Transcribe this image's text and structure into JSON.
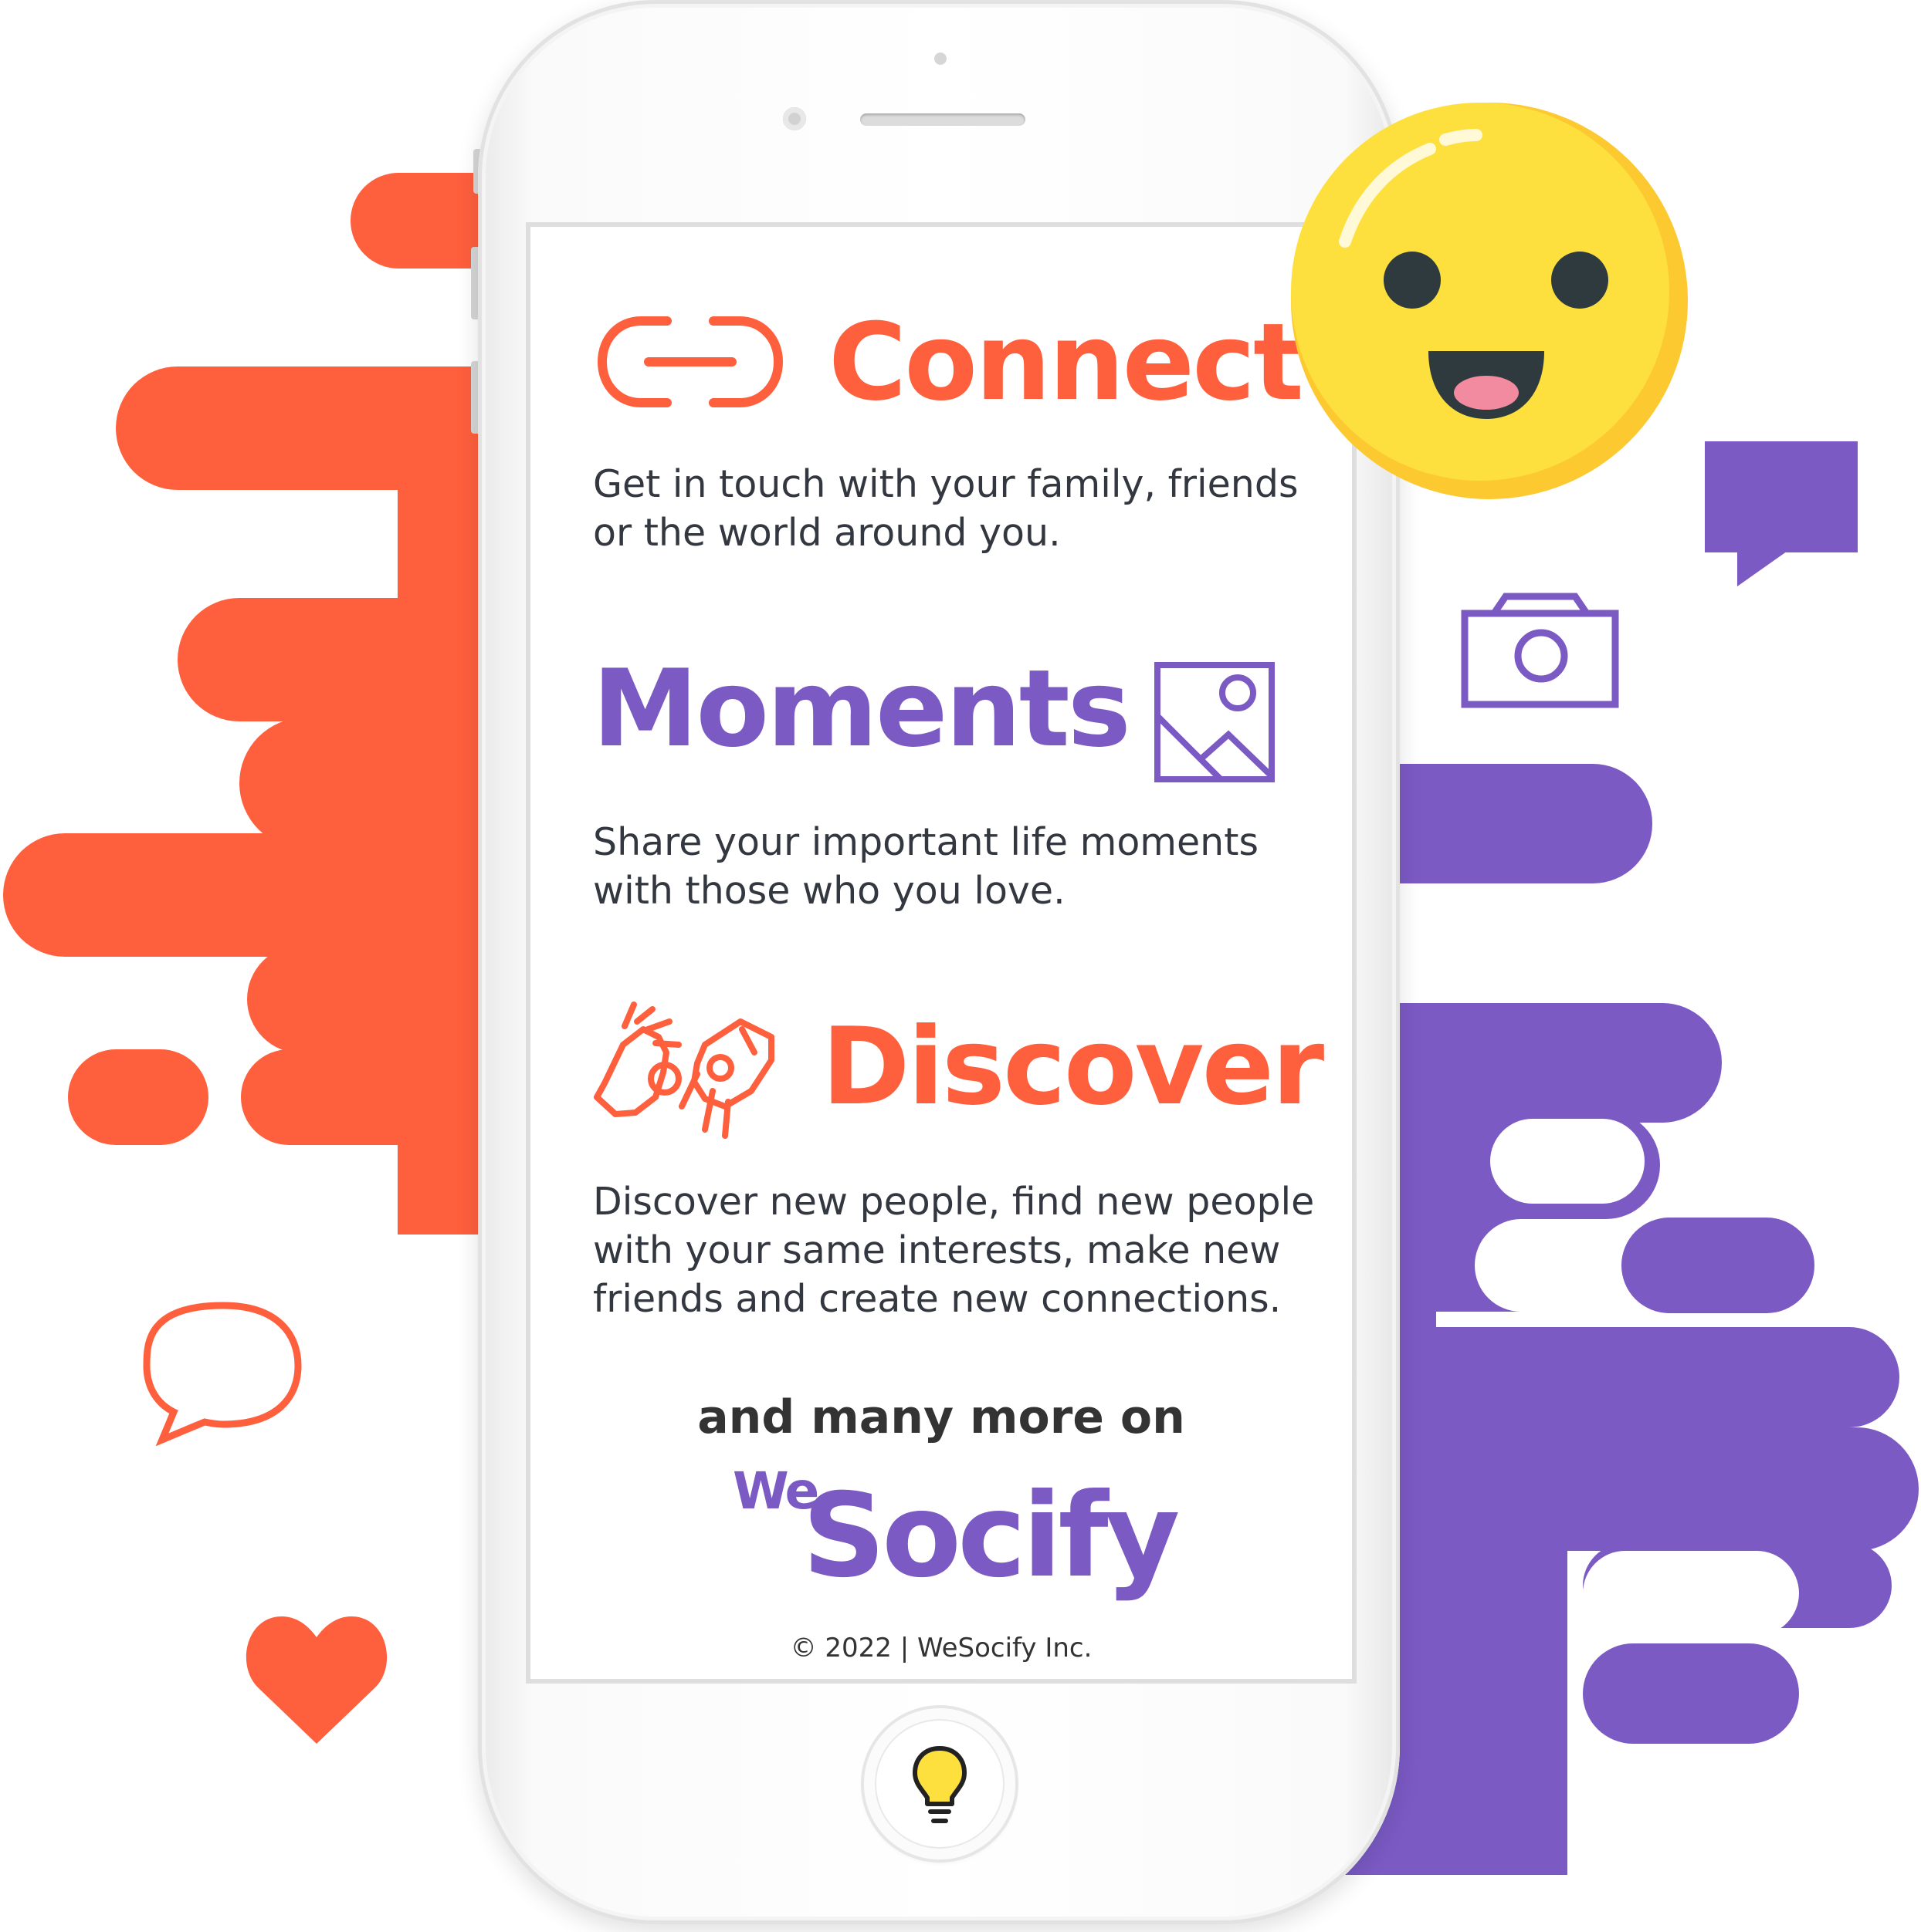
{
  "sections": {
    "connect": {
      "title": "Connect",
      "description_lines": [
        "Get in touch with your family, friends",
        "or the world around you."
      ]
    },
    "moments": {
      "title": "Moments",
      "description_lines": [
        "Share your important life moments",
        "with those who you love."
      ]
    },
    "discover": {
      "title": "Discover",
      "description_lines": [
        "Discover new people, find new people",
        "with your same interests, make new",
        "friends and create new connections."
      ]
    }
  },
  "closing": {
    "tagline": "and many more on",
    "logo_we": "We",
    "logo_socify": "Socify",
    "copyright": "© 2022 | WeSocify Inc."
  },
  "icons": {
    "connect": "link-icon",
    "moments": "image-icon",
    "discover": "sign-language-icon",
    "home": "lightbulb-icon",
    "emoji": "smiling-face-icon",
    "camera": "camera-icon",
    "chat_filled": "speech-bubble-icon",
    "chat_outline": "chat-bubble-icon",
    "heart": "heart-icon"
  },
  "colors": {
    "orange": "#fe5f3d",
    "purple": "#7b5ac4",
    "emoji_yellow": "#fde03d",
    "text_dark": "#333740"
  }
}
